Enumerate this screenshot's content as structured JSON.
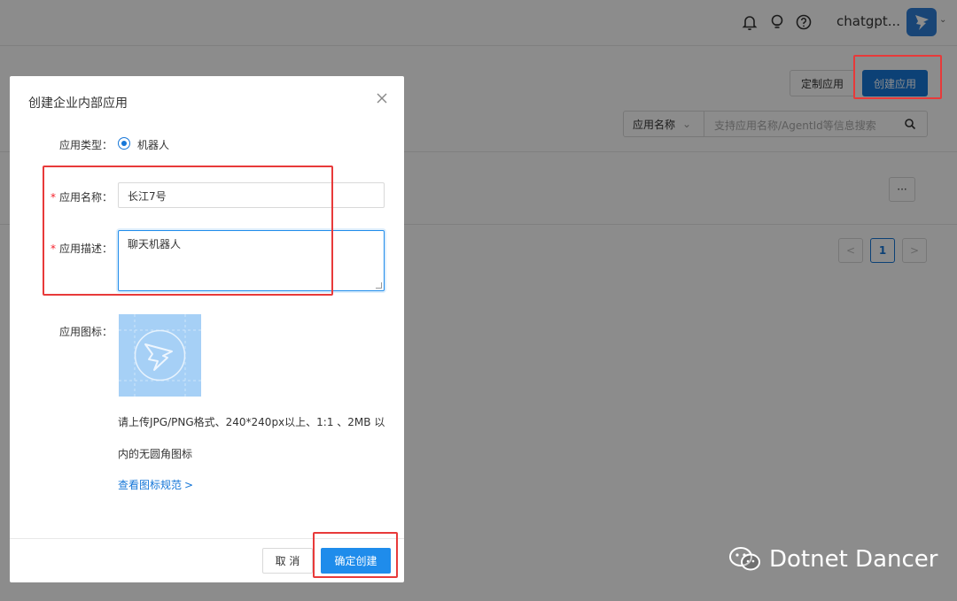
{
  "topbar": {
    "user_name": "chatgpt...",
    "icons": [
      "bell-icon",
      "bulb-icon",
      "help-icon",
      "chevron-down-icon"
    ]
  },
  "toolbar": {
    "custom_app_label": "定制应用",
    "create_app_label": "创建应用"
  },
  "search": {
    "field_select": "应用名称",
    "placeholder": "支持应用名称/AgentId等信息搜索"
  },
  "pagination": {
    "current_page": "1"
  },
  "row_actions": {
    "more_label": "···"
  },
  "modal": {
    "title": "创建企业内部应用",
    "type_label": "应用类型：",
    "type_value": "机器人",
    "name_label": "应用名称：",
    "name_value": "长江7号",
    "desc_label": "应用描述：",
    "desc_value": "聊天机器人",
    "icon_label": "应用图标：",
    "icon_hint_line1": "请上传JPG/PNG格式、240*240px以上、1:1 、2MB 以",
    "icon_hint_line2": "内的无圆角图标",
    "icon_spec_link": "查看图标规范",
    "cancel_label": "取 消",
    "confirm_label": "确定创建",
    "required_mark": "*"
  },
  "watermark": {
    "text": "Dotnet Dancer"
  },
  "colors": {
    "primary": "#1f8ceb",
    "highlight_box": "#e83a3a",
    "required": "#f5222d",
    "icon_placeholder": "#a6d0f6"
  }
}
